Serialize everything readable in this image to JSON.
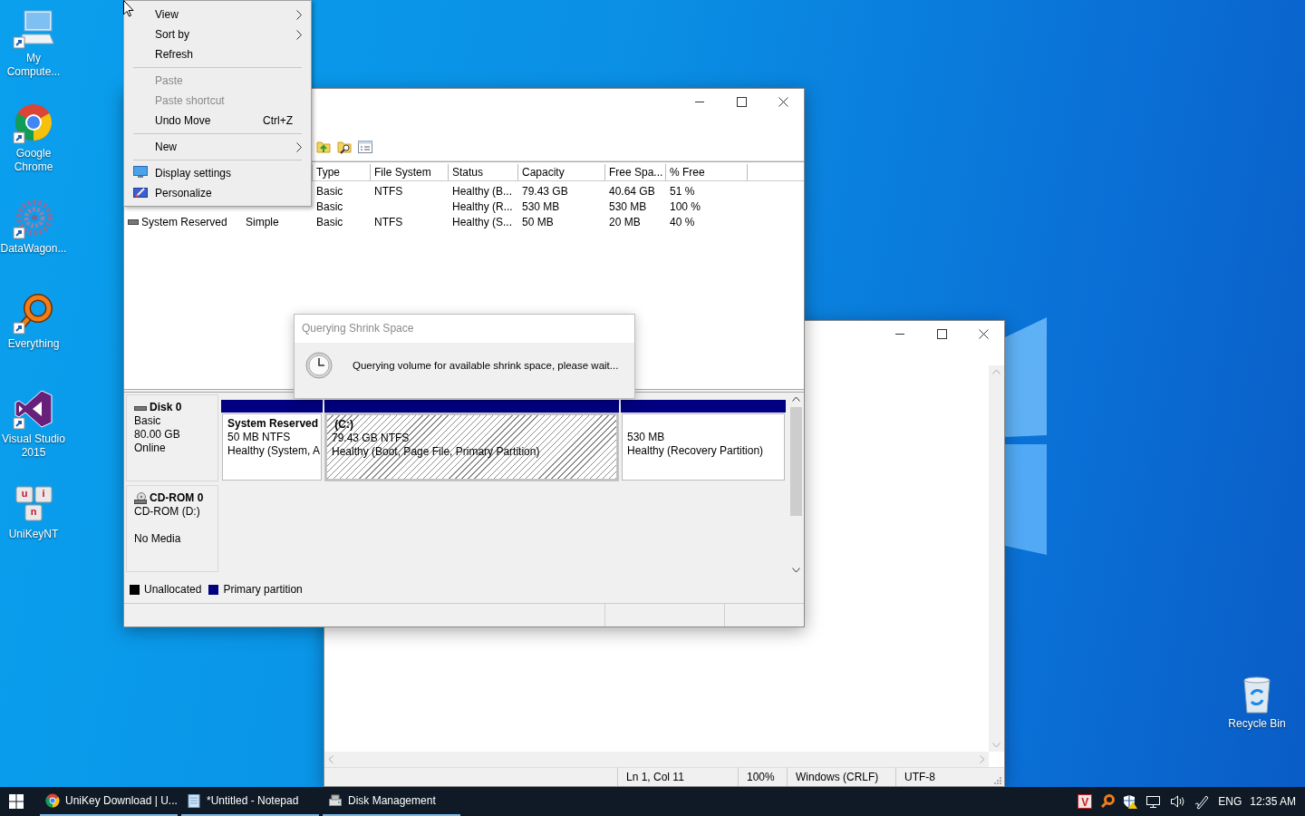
{
  "desktop_icons": [
    {
      "label": "My Compute...",
      "kind": "computer",
      "shortcut": true
    },
    {
      "label": "Google Chrome",
      "kind": "chrome",
      "shortcut": true
    },
    {
      "label": "DataWagon...",
      "kind": "gear",
      "shortcut": true
    },
    {
      "label": "Everything",
      "kind": "magnifier",
      "shortcut": true
    },
    {
      "label": "Visual Studio 2015",
      "kind": "vs",
      "shortcut": true
    },
    {
      "label": "UniKeyNT",
      "kind": "keys",
      "shortcut": false,
      "key_letters": [
        "u",
        "i",
        "n"
      ]
    }
  ],
  "recycle_bin": {
    "label": "Recycle Bin"
  },
  "notepad": {
    "status_bar": [
      "Ln 1, Col 11",
      "100%",
      "Windows (CRLF)",
      "UTF-8"
    ]
  },
  "disk_management": {
    "columns": [
      "Type",
      "File System",
      "Status",
      "Capacity",
      "Free Spa...",
      "% Free"
    ],
    "rows": [
      {
        "cells": [
          "Basic",
          "NTFS",
          "Healthy (B...",
          "79.43 GB",
          "40.64 GB",
          "51 %"
        ]
      },
      {
        "cells": [
          "Basic",
          "",
          "Healthy (R...",
          "530 MB",
          "530 MB",
          "100 %"
        ]
      },
      {
        "volume": "System Reserved",
        "layout": "Simple",
        "cells": [
          "Basic",
          "NTFS",
          "Healthy (S...",
          "50 MB",
          "20 MB",
          "40 %"
        ]
      }
    ],
    "disks": [
      {
        "kind": "disk",
        "name": "Disk 0",
        "type": "Basic",
        "size": "80.00 GB",
        "status": "Online",
        "partitions": [
          {
            "title": "System Reserved",
            "lines": [
              "50 MB NTFS",
              "Healthy (System, A"
            ],
            "selected": false
          },
          {
            "title": " (C:)",
            "lines": [
              "79.43 GB NTFS",
              "Healthy (Boot, Page File, Primary Partition)"
            ],
            "selected": true
          },
          {
            "lines": [
              "530 MB",
              "Healthy (Recovery Partition)"
            ],
            "selected": false
          }
        ]
      },
      {
        "kind": "cdrom",
        "name": "CD-ROM 0",
        "type": "CD-ROM (D:)",
        "status": "No Media"
      }
    ],
    "legend": [
      {
        "label": "Unallocated",
        "color": "#000000"
      },
      {
        "label": "Primary partition",
        "color": "#000080"
      }
    ]
  },
  "dialog": {
    "title": "Querying Shrink Space",
    "message": "Querying volume for available shrink space, please wait..."
  },
  "context_menu": {
    "items": [
      {
        "kind": "item",
        "label": "View",
        "submenu": true,
        "disabled": false
      },
      {
        "kind": "item",
        "label": "Sort by",
        "submenu": true,
        "disabled": false
      },
      {
        "kind": "item",
        "label": "Refresh",
        "disabled": false
      },
      {
        "kind": "separator"
      },
      {
        "kind": "item",
        "label": "Paste",
        "disabled": true
      },
      {
        "kind": "item",
        "label": "Paste shortcut",
        "disabled": true
      },
      {
        "kind": "item",
        "label": "Undo Move",
        "shortcut": "Ctrl+Z",
        "disabled": false
      },
      {
        "kind": "separator"
      },
      {
        "kind": "item",
        "label": "New",
        "submenu": true,
        "disabled": false
      },
      {
        "kind": "separator"
      },
      {
        "kind": "display",
        "label": "Display settings",
        "disabled": false
      },
      {
        "kind": "personalize",
        "label": "Personalize",
        "disabled": false
      }
    ]
  },
  "taskbar": {
    "items": [
      {
        "label": "UniKey Download | U...",
        "kind": "chrome"
      },
      {
        "label": "*Untitled - Notepad",
        "kind": "notepad"
      },
      {
        "label": "Disk Management",
        "kind": "disk"
      }
    ],
    "input_mode": "V",
    "language": "ENG",
    "time": "12:35 AM"
  }
}
